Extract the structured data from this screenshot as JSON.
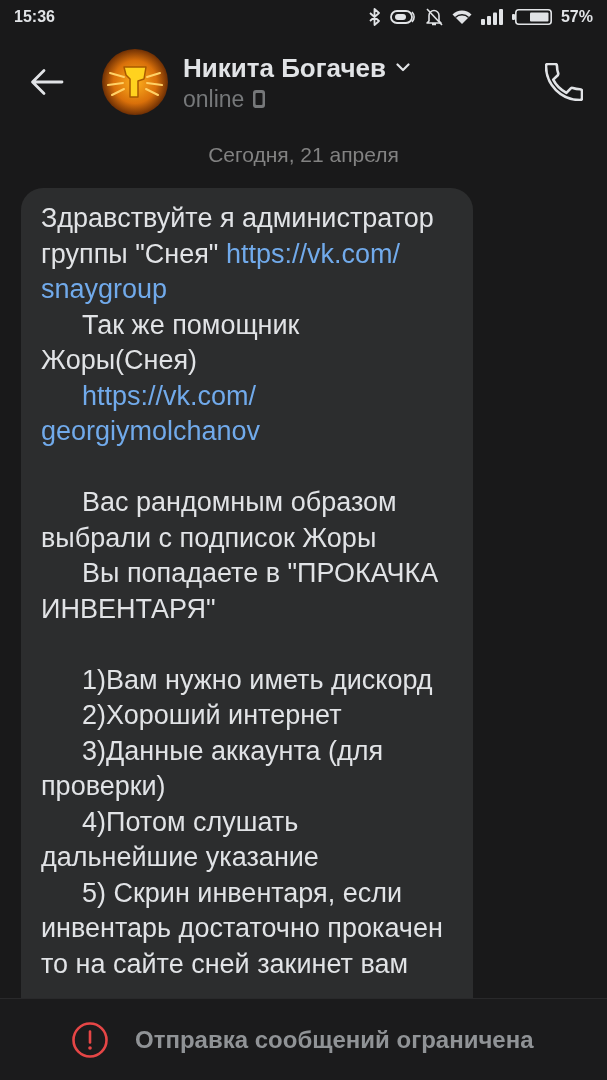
{
  "status_bar": {
    "time": "15:36",
    "battery_text": "57%"
  },
  "header": {
    "contact_name": "Никита Богачев",
    "status": "online"
  },
  "date_separator": "Сегодня, 21 апреля",
  "message": {
    "sections": [
      {
        "paragraphs": [
          {
            "kind": "plain",
            "parts": [
              {
                "kind": "text",
                "text": "Здравствуйте я администратор группы \"Снея\" "
              },
              {
                "kind": "link",
                "segments": [
                  "https://vk.com/",
                  "snaygroup"
                ]
              }
            ]
          },
          {
            "kind": "indented",
            "parts": [
              {
                "kind": "text",
                "text": "Так же помощник Жоры(Снея)"
              }
            ]
          },
          {
            "kind": "indented",
            "parts": [
              {
                "kind": "link",
                "segments": [
                  "https://vk.com/",
                  "georgiymolchanov"
                ]
              }
            ]
          }
        ]
      },
      {
        "paragraphs": [
          {
            "kind": "indented",
            "parts": [
              {
                "kind": "text",
                "text": "Вас рандомным образом выбрали с подписок Жоры"
              }
            ]
          },
          {
            "kind": "indented",
            "parts": [
              {
                "kind": "text",
                "text": "Вы попадаете в \"ПРОКАЧКА ИНВЕНТАРЯ\""
              }
            ]
          }
        ]
      },
      {
        "paragraphs": [
          {
            "kind": "indented",
            "parts": [
              {
                "kind": "text",
                "text": "1)Вам нужно иметь дискорд"
              }
            ]
          },
          {
            "kind": "indented",
            "parts": [
              {
                "kind": "text",
                "text": "2)Хороший интернет"
              }
            ]
          },
          {
            "kind": "indented",
            "parts": [
              {
                "kind": "text",
                "text": "3)Данные аккаунта (для проверки)"
              }
            ]
          },
          {
            "kind": "indented",
            "parts": [
              {
                "kind": "text",
                "text": "4)Потом слушать дальнейшие указание"
              }
            ]
          },
          {
            "kind": "indented",
            "parts": [
              {
                "kind": "text",
                "text": "5) Скрин инвентаря, если инвентарь достаточно прокачен то на сайте сней закинет вам"
              }
            ]
          }
        ]
      }
    ]
  },
  "footer": {
    "notice": "Отправка сообщений ограничена"
  }
}
